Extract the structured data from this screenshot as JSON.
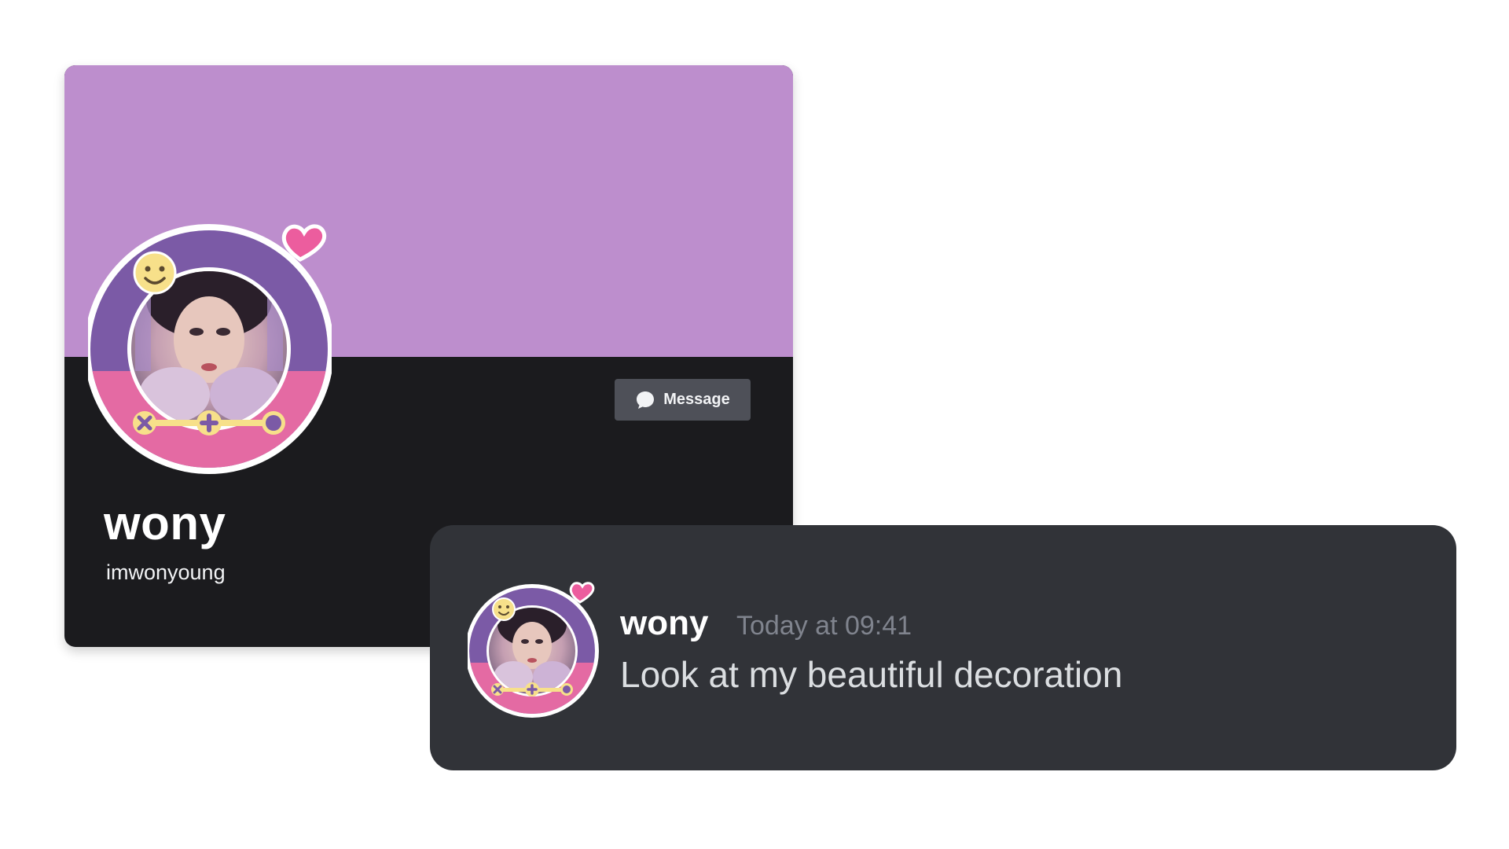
{
  "colors": {
    "banner": "#bd8ecd",
    "card_body": "#1b1b1e",
    "button_bg": "#4e5058",
    "chat_bg": "#313338",
    "timestamp": "#80848e",
    "message_text": "#dbdee1",
    "decoration_purple": "#7b5aa6",
    "decoration_pink": "#e46aa3",
    "decoration_yellow": "#f7e08a",
    "heart": "#ec5d9e"
  },
  "profile": {
    "display_name": "wony",
    "username": "imwonyoung",
    "message_button": {
      "label": "Message",
      "icon": "chat-bubble-icon"
    },
    "avatar_decoration": {
      "icons": [
        "smiley-icon",
        "heart-icon",
        "x-icon",
        "plus-icon",
        "dot-icon"
      ]
    }
  },
  "chat": {
    "author": "wony",
    "timestamp": "Today at 09:41",
    "text": "Look at my beautiful decoration"
  }
}
